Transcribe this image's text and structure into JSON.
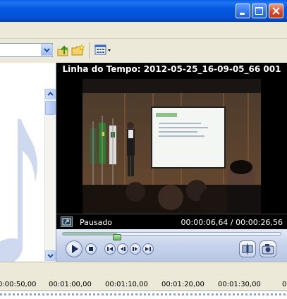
{
  "window": {
    "minimize_icon": "minimize-icon",
    "maximize_icon": "maximize-icon",
    "close_icon": "close-icon"
  },
  "toolbar": {
    "address_value": "",
    "up_icon": "folder-up-icon",
    "new_folder_icon": "new-folder-icon",
    "view_icon": "view-options-icon"
  },
  "monitor": {
    "title": "Linha do Tempo: 2012-05-25_16-09-05_66 001",
    "status": "Pausado",
    "time": "00:00:06,64 / 00:00:26,56",
    "progress_fraction": 0.25
  },
  "timeline": {
    "ticks": [
      "0:00:50,00",
      "00:01:00,00",
      "00:01:10,00",
      "00:01:20,00",
      "00:01:30,00",
      "0"
    ]
  },
  "colors": {
    "titlebar": "#0657e0",
    "monitor_bg": "#000000",
    "seek_thumb": "#62b35a"
  }
}
